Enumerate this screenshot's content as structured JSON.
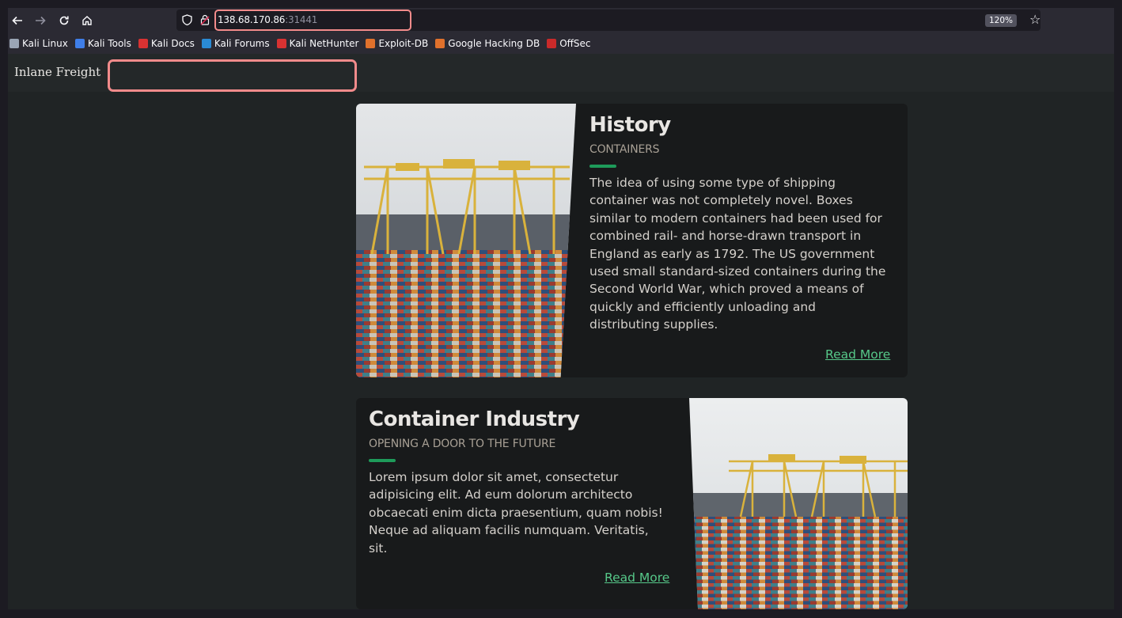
{
  "browser": {
    "url_host": "138.68.170.86",
    "url_port": ":31441",
    "zoom": "120%"
  },
  "bookmarks": [
    {
      "label": "Kali Linux",
      "icon": "kali-dragon-icon",
      "color": "#9aa5b5"
    },
    {
      "label": "Kali Tools",
      "icon": "kali-tools-icon",
      "color": "#3f7ee8"
    },
    {
      "label": "Kali Docs",
      "icon": "kali-docs-icon",
      "color": "#d93232"
    },
    {
      "label": "Kali Forums",
      "icon": "kali-forums-icon",
      "color": "#2a8ad4"
    },
    {
      "label": "Kali NetHunter",
      "icon": "nethunter-icon",
      "color": "#d93232"
    },
    {
      "label": "Exploit-DB",
      "icon": "exploit-db-icon",
      "color": "#e0712c"
    },
    {
      "label": "Google Hacking DB",
      "icon": "ghdb-icon",
      "color": "#e0712c"
    },
    {
      "label": "OffSec",
      "icon": "offsec-icon",
      "color": "#c92a2a"
    }
  ],
  "site": {
    "brand": "Inlane Freight"
  },
  "cards": [
    {
      "title": "History",
      "subtitle": "CONTAINERS",
      "body": [
        "The idea of using some type of shipping",
        "container was not completely novel. Boxes",
        "similar to modern containers had been used for",
        "combined rail- and horse-drawn transport in",
        "England as early as 1792. The US government",
        "used small standard-sized containers during the",
        "Second World War, which proved a means of",
        "quickly and efficiently unloading and",
        "distributing supplies."
      ],
      "link": "Read More"
    },
    {
      "title": "Container Industry",
      "subtitle": "OPENING A DOOR TO THE FUTURE",
      "body": [
        "Lorem ipsum dolor sit amet, consectetur",
        "adipisicing elit. Ad eum dolorum architecto",
        "obcaecati enim dicta praesentium, quam nobis!",
        "Neque ad aliquam facilis numquam. Veritatis,",
        "sit."
      ],
      "link": "Read More"
    }
  ],
  "colors": {
    "accent": "#1e9b5a",
    "link": "#56c889",
    "highlight": "#f28b8b"
  }
}
